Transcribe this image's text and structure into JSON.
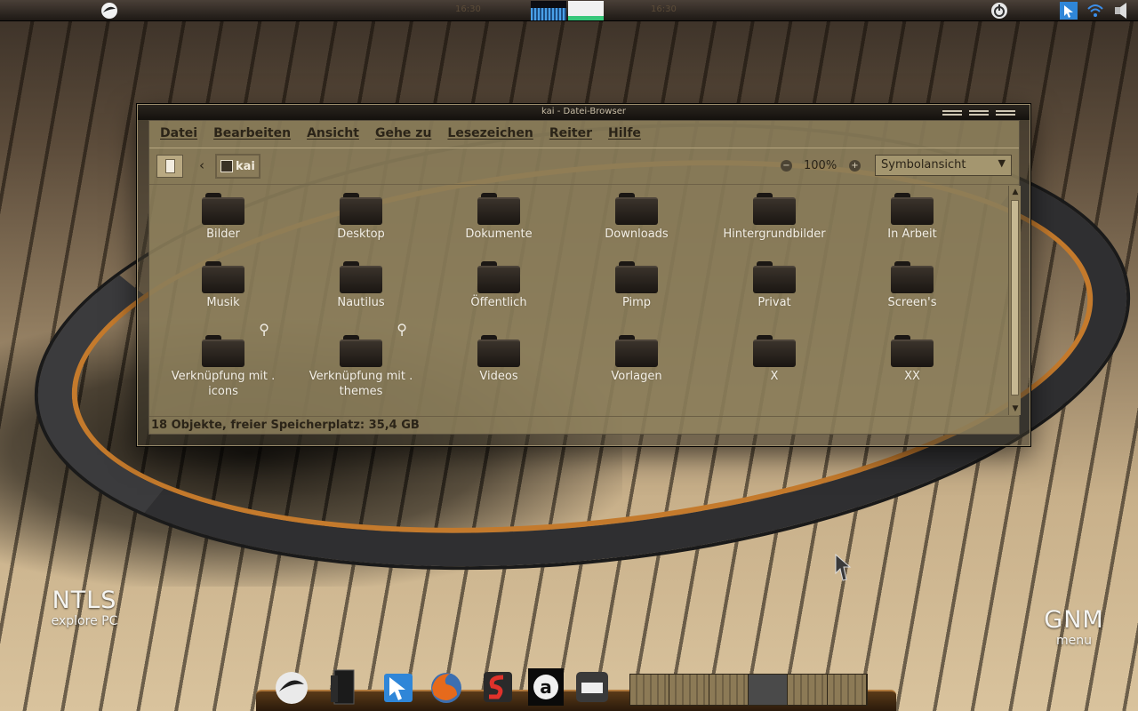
{
  "top_panel": {
    "clock_left": "16:30",
    "clock_right": "16:30",
    "accent_cpu": "#4aa0e8",
    "accent_mem": "#37c77a",
    "icons": [
      "system-logo-icon",
      "power-icon",
      "cursor-app-icon",
      "wifi-icon",
      "audio-icon"
    ]
  },
  "window": {
    "title": "kai - Datei-Browser",
    "menu": [
      "Datei",
      "Bearbeiten",
      "Ansicht",
      "Gehe zu",
      "Lesezeichen",
      "Reiter",
      "Hilfe"
    ],
    "location": "kai",
    "zoom": "100%",
    "view_mode": "Symbolansicht",
    "items": [
      {
        "label": "Bilder",
        "link": false
      },
      {
        "label": "Desktop",
        "link": false
      },
      {
        "label": "Dokumente",
        "link": false
      },
      {
        "label": "Downloads",
        "link": false
      },
      {
        "label": "Hintergrundbilder",
        "link": false
      },
      {
        "label": "In Arbeit",
        "link": false
      },
      {
        "label": "Musik",
        "link": false
      },
      {
        "label": "Nautilus",
        "link": false
      },
      {
        "label": "Öffentlich",
        "link": false
      },
      {
        "label": "Pimp",
        "link": false
      },
      {
        "label": "Privat",
        "link": false
      },
      {
        "label": "Screen's",
        "link": false
      },
      {
        "label": "Verknüpfung mit . icons",
        "link": true
      },
      {
        "label": "Verknüpfung mit . themes",
        "link": true
      },
      {
        "label": "Videos",
        "link": false
      },
      {
        "label": "Vorlagen",
        "link": false
      },
      {
        "label": "X",
        "link": false
      },
      {
        "label": "XX",
        "link": false
      }
    ],
    "status": "18 Objekte, freier Speicherplatz: 35,4 GB"
  },
  "desktop": {
    "left_brand": {
      "big": "NTLS",
      "small": "explore PC"
    },
    "right_brand": {
      "big": "GNM",
      "small": "menu"
    }
  },
  "dock": {
    "apps": [
      "ubuntu-logo-icon",
      "bookmark-icon",
      "cursor-app-icon",
      "firefox-icon",
      "scribus-icon",
      "amazon-icon",
      "drive-icon"
    ],
    "workspaces": 6,
    "active_workspace": 4
  }
}
